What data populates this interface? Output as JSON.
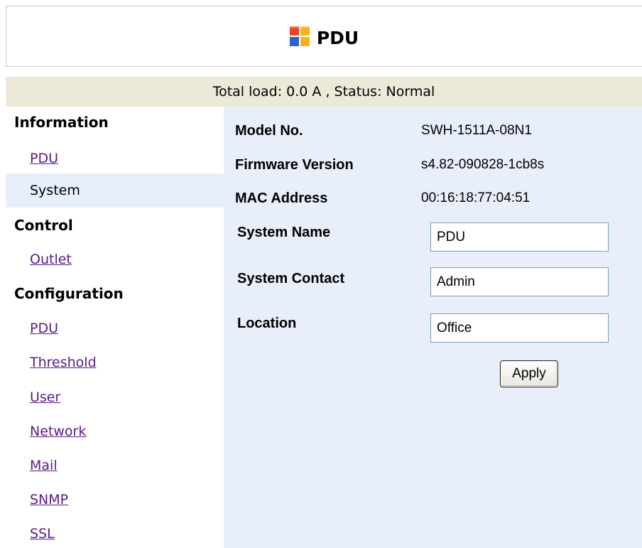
{
  "header": {
    "title": "PDU",
    "logo_icon": "windows-logo-icon"
  },
  "status_bar": {
    "text": "Total load: 0.0 A , Status: Normal"
  },
  "sidebar": {
    "sections": [
      {
        "heading": "Information",
        "items": [
          "PDU",
          "System"
        ]
      },
      {
        "heading": "Control",
        "items": [
          "Outlet"
        ]
      },
      {
        "heading": "Configuration",
        "items": [
          "PDU",
          "Threshold",
          "User",
          "Network",
          "Mail",
          "SNMP",
          "SSL"
        ]
      }
    ],
    "active_item": "System"
  },
  "info": {
    "model_label": "Model No.",
    "model_value": "SWH-1511A-08N1",
    "firmware_label": "Firmware Version",
    "firmware_value": "s4.82-090828-1cb8s",
    "mac_label": "MAC Address",
    "mac_value": "00:16:18:77:04:51"
  },
  "form": {
    "system_name_label": "System Name",
    "system_name_value": "PDU",
    "system_contact_label": "System Contact",
    "system_contact_value": "Admin",
    "location_label": "Location",
    "location_value": "Office",
    "apply_label": "Apply"
  },
  "colors": {
    "status_bar_bg": "#ece9d8",
    "content_bg": "#e8effb",
    "link": "#5a1a86"
  }
}
